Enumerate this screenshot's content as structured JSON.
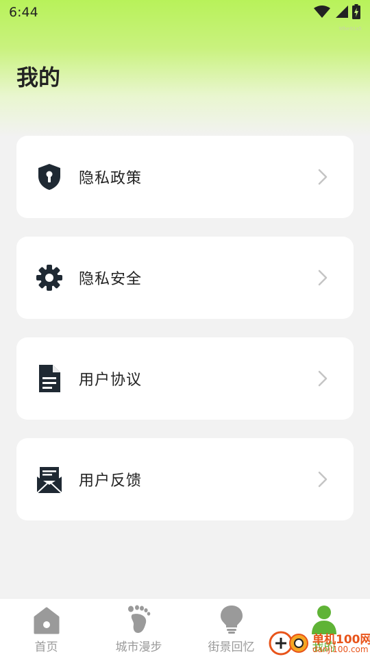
{
  "status_bar": {
    "time": "6:44",
    "build_tag": "9fbe91a5"
  },
  "header": {
    "title": "我的"
  },
  "menu": [
    {
      "label": "隐私政策",
      "icon": "shield-lock-icon"
    },
    {
      "label": "隐私安全",
      "icon": "gear-icon"
    },
    {
      "label": "用户协议",
      "icon": "document-icon"
    },
    {
      "label": "用户反馈",
      "icon": "mail-feedback-icon"
    }
  ],
  "bottom_nav": [
    {
      "label": "首页",
      "icon": "home-icon",
      "active": false
    },
    {
      "label": "城市漫步",
      "icon": "footprint-icon",
      "active": false
    },
    {
      "label": "街景回忆",
      "icon": "lightbulb-icon",
      "active": false
    },
    {
      "label": "我的",
      "icon": "person-icon",
      "active": true
    }
  ],
  "watermark": {
    "text": "单机100网",
    "sub": "danji100.com"
  },
  "colors": {
    "accent": "#5fb336",
    "header_gradient": "#b8f25a",
    "icon_dark": "#1f2933",
    "inactive": "#9a9a9a"
  }
}
